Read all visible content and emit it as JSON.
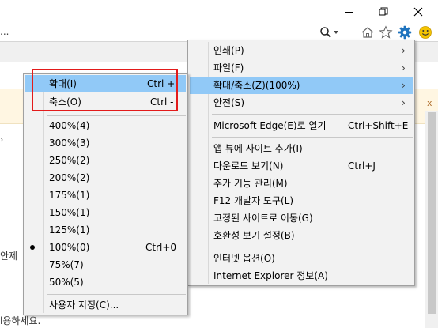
{
  "window": {
    "min_icon": "minimize-icon",
    "restore_icon": "restore-icon",
    "close_icon": "close-icon"
  },
  "address_bar": {
    "left_text": "...",
    "search_icon": "search-icon",
    "dropdown_icon": "chevron-down-icon"
  },
  "toolbar": {
    "icons": [
      "home-icon",
      "star-icon",
      "gear-icon",
      "smiley-icon"
    ],
    "gear_color": "#1e73be",
    "smile_color": "#f5c400"
  },
  "page": {
    "left_marker": "›",
    "edge_text": "안제",
    "bottom_text": "l용하세요.",
    "notice_right": "x"
  },
  "main_menu": {
    "items": [
      {
        "label": "인쇄(P)",
        "submenu": true
      },
      {
        "label": "파일(F)",
        "submenu": true
      },
      {
        "label": "확대/축소(Z)(100%)",
        "submenu": true,
        "highlighted": true
      },
      {
        "label": "안전(S)",
        "submenu": true
      },
      {
        "label": "Microsoft Edge(E)로 열기",
        "shortcut": "Ctrl+Shift+E"
      },
      {
        "label": "앱 뷰에 사이트 추가(I)"
      },
      {
        "label": "다운로드 보기(N)",
        "shortcut": "Ctrl+J"
      },
      {
        "label": "추가 기능 관리(M)"
      },
      {
        "label": "F12 개발자 도구(L)"
      },
      {
        "label": "고정된 사이트로 이동(G)"
      },
      {
        "label": "호환성 보기 설정(B)"
      },
      {
        "label": "인터넷 옵션(O)"
      },
      {
        "label": "Internet Explorer 정보(A)"
      }
    ],
    "submenu_arrow": "›"
  },
  "zoom_menu": {
    "zoom_in": {
      "label": "확대(I)",
      "shortcut": "Ctrl +"
    },
    "zoom_out": {
      "label": "축소(O)",
      "shortcut": "Ctrl -"
    },
    "levels": [
      {
        "label": "400%(4)"
      },
      {
        "label": "300%(3)"
      },
      {
        "label": "250%(2)"
      },
      {
        "label": "200%(2)"
      },
      {
        "label": "175%(1)"
      },
      {
        "label": "150%(1)"
      },
      {
        "label": "125%(1)"
      },
      {
        "label": "100%(0)",
        "shortcut": "Ctrl+0",
        "selected": true
      },
      {
        "label": "75%(7)"
      },
      {
        "label": "50%(5)"
      }
    ],
    "custom": {
      "label": "사용자 지정(C)..."
    },
    "highlight_color": "#91c9f7",
    "callout_color": "#e31b1b"
  }
}
